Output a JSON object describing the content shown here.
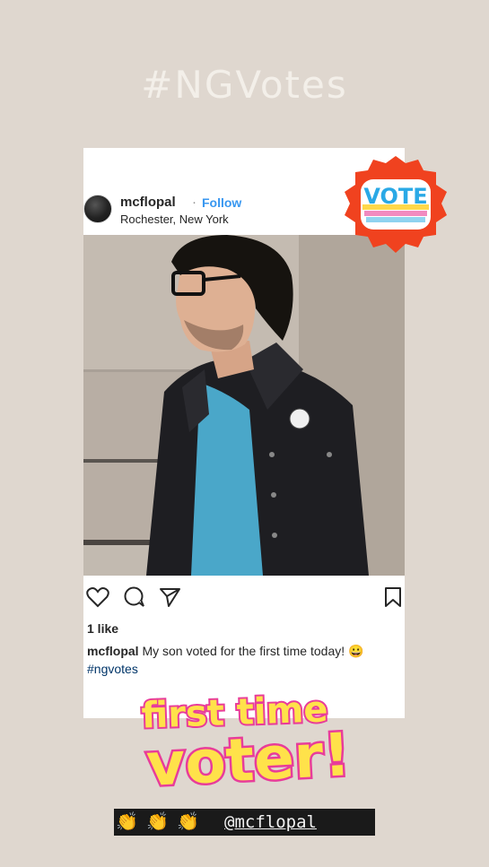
{
  "story": {
    "hashtag_title": "#NGVotes",
    "mention": "@mcflopal"
  },
  "post": {
    "username": "mcflopal",
    "separator": "·",
    "follow_label": "Follow",
    "location": "Rochester, New York",
    "likes": "1 like",
    "caption_user": "mcflopal",
    "caption_text": " My son voted for the first time today! 😀 ",
    "caption_hashtag": "#ngvotes"
  },
  "stickers": {
    "vote_badge_text": "VOTE",
    "first_time_line1": "first time",
    "first_time_line2": "voter!"
  },
  "colors": {
    "background": "#dfd7cf",
    "follow_blue": "#3897f0",
    "sticker_yellow": "#ffe24a",
    "sticker_pink": "#e83c9a",
    "vote_red": "#f0421f",
    "shirt_teal": "#4aa7c9"
  },
  "icons": [
    "heart-icon",
    "comment-icon",
    "share-icon",
    "bookmark-icon",
    "clap-emoji"
  ]
}
